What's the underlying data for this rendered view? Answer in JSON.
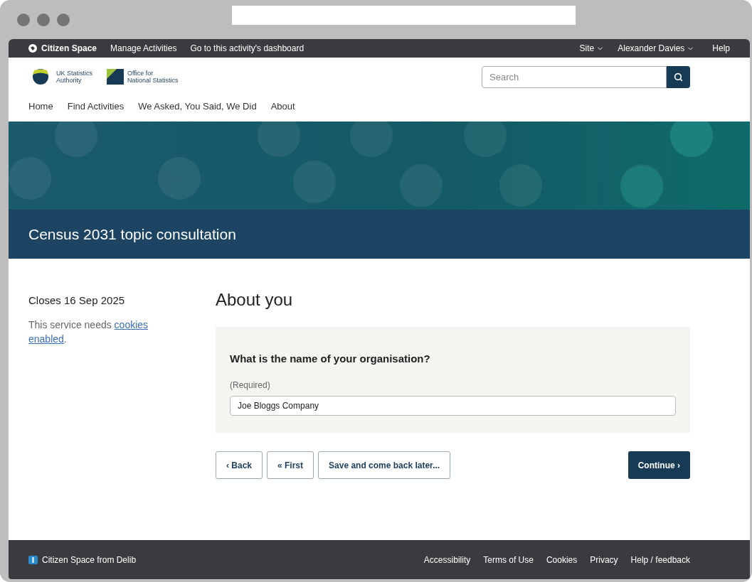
{
  "admin_bar": {
    "brand": "Citizen Space",
    "links": [
      "Manage Activities",
      "Go to this activity's dashboard"
    ],
    "menus": [
      {
        "label": "Site",
        "dropdown": true
      },
      {
        "label": "Alexander Davies",
        "dropdown": true
      },
      {
        "label": "Help",
        "dropdown": false
      }
    ]
  },
  "header": {
    "logos": [
      {
        "kind": "uksa",
        "text": [
          "UK Statistics",
          "Authority"
        ]
      },
      {
        "kind": "ons",
        "text": [
          "Office for",
          "National Statistics"
        ]
      }
    ],
    "search": {
      "placeholder": "Search"
    }
  },
  "nav": [
    {
      "label": "Home"
    },
    {
      "label": "Find Activities"
    },
    {
      "label": "We Asked, You Said, We Did"
    },
    {
      "label": "About"
    }
  ],
  "title": "Census 2031 topic consultation",
  "sidebar": {
    "closes": "Closes 16 Sep 2025",
    "notice": "This service needs ",
    "notice_link": [
      "cookies",
      "enabled"
    ],
    "notice_end": "."
  },
  "page_heading": "About you",
  "question": {
    "label": "What is the name of your organisation?",
    "hint": "(Required)",
    "value": "Joe Bloggs Company"
  },
  "buttons": [
    {
      "label": "‹ Back",
      "kind": "secondary"
    },
    {
      "label": "« First",
      "kind": "secondary"
    },
    {
      "label": "Save and come back later...",
      "kind": "secondary"
    },
    {
      "label": "Continue ›",
      "kind": "primary"
    }
  ],
  "footer": {
    "brand": "Citizen Space from Delib",
    "links": [
      "Accessibility",
      "Terms of Use",
      "Cookies",
      "Privacy",
      "Help / feedback"
    ]
  }
}
